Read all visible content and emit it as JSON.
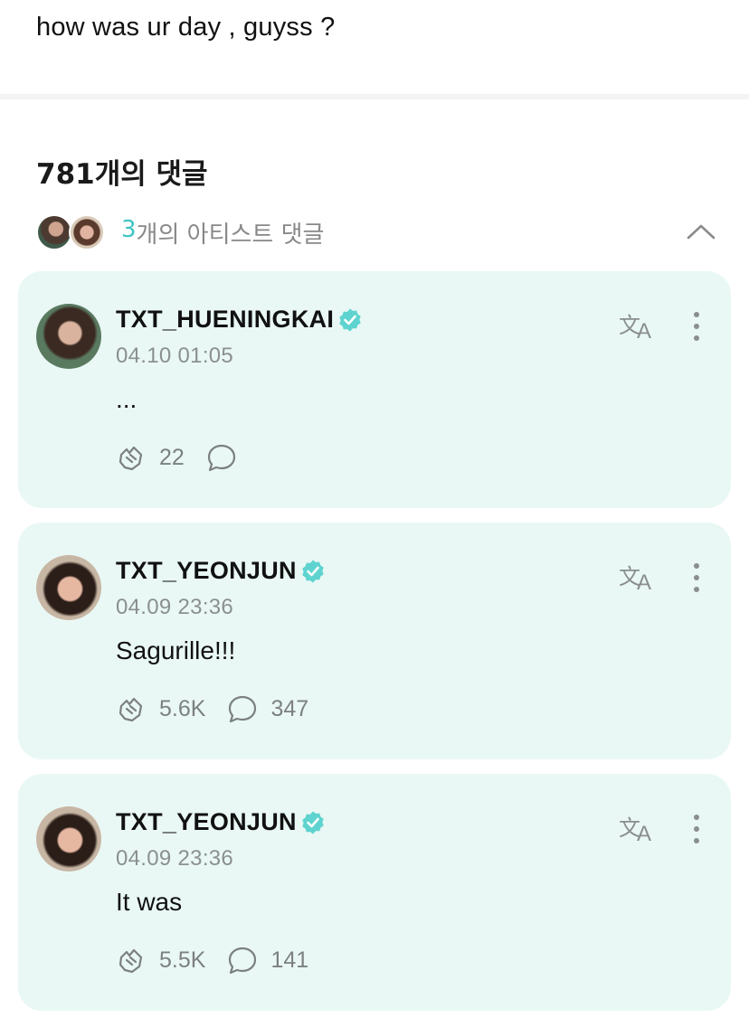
{
  "post": {
    "text": "how was ur day , guyss ?"
  },
  "comments_section": {
    "count_label": "781개의 댓글",
    "artist_comments": {
      "count": "3",
      "label": "개의 아티스트 댓글"
    }
  },
  "comments": [
    {
      "author": "TXT_HUENINGKAI",
      "time": "04.10 01:05",
      "text": "...",
      "likes": "22",
      "replies": ""
    },
    {
      "author": "TXT_YEONJUN",
      "time": "04.09 23:36",
      "text": "Sagurille!!!",
      "likes": "5.6K",
      "replies": "347"
    },
    {
      "author": "TXT_YEONJUN",
      "time": "04.09 23:36",
      "text": "It was",
      "likes": "5.5K",
      "replies": "141"
    }
  ],
  "colors": {
    "accent": "#3dc4c4",
    "verified": "#5fd3cf",
    "card_bg": "#e9f8f5",
    "muted": "#8b8f90"
  },
  "icons": {
    "verified": "verified-badge-icon",
    "translate": "translate-icon",
    "more": "more-vertical-icon",
    "like": "like-hand-icon",
    "reply": "reply-bubble-icon",
    "collapse": "chevron-up-icon"
  }
}
